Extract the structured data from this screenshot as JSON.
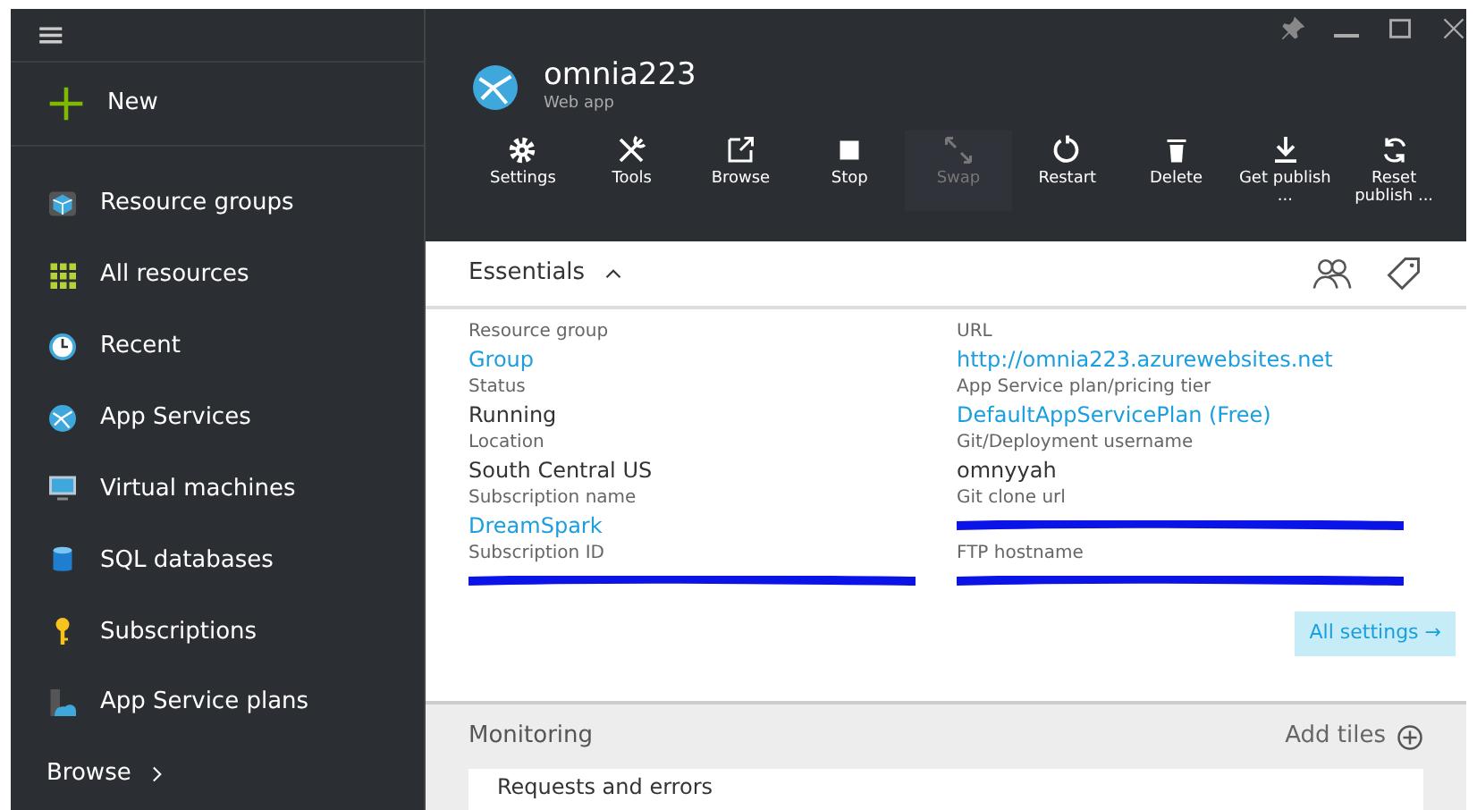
{
  "sidebar": {
    "menu_icon": "≡",
    "new_label": "New",
    "items": [
      {
        "label": "Resource groups"
      },
      {
        "label": "All resources"
      },
      {
        "label": "Recent"
      },
      {
        "label": "App Services"
      },
      {
        "label": "Virtual machines"
      },
      {
        "label": "SQL databases"
      },
      {
        "label": "Subscriptions"
      },
      {
        "label": "App Service plans"
      }
    ],
    "browse": "Browse"
  },
  "blade": {
    "title": "omnia223",
    "subtitle": "Web app",
    "toolbar": [
      {
        "label": "Settings",
        "disabled": false
      },
      {
        "label": "Tools",
        "disabled": false
      },
      {
        "label": "Browse",
        "disabled": false
      },
      {
        "label": "Stop",
        "disabled": false
      },
      {
        "label": "Swap",
        "disabled": true
      },
      {
        "label": "Restart",
        "disabled": false
      },
      {
        "label": "Delete",
        "disabled": false
      },
      {
        "label": "Get publish ...",
        "disabled": false
      },
      {
        "label": "Reset publish ...",
        "disabled": false
      }
    ]
  },
  "essentials": {
    "title": "Essentials",
    "expanded": true,
    "left": [
      {
        "label": "Resource group",
        "value": "Group",
        "kind": "link"
      },
      {
        "label": "Status",
        "value": "Running",
        "kind": "text"
      },
      {
        "label": "Location",
        "value": "South Central US",
        "kind": "text"
      },
      {
        "label": "Subscription name",
        "value": "DreamSpark",
        "kind": "link"
      },
      {
        "label": "Subscription ID",
        "kind": "redacted"
      }
    ],
    "right": [
      {
        "label": "URL",
        "value": "http://omnia223.azurewebsites.net",
        "kind": "link"
      },
      {
        "label": "App Service plan/pricing tier",
        "value": "DefaultAppServicePlan (Free)",
        "kind": "link"
      },
      {
        "label": "Git/Deployment username",
        "value": "omnyyah",
        "kind": "text"
      },
      {
        "label": "Git clone url",
        "kind": "redacted"
      },
      {
        "label": "FTP hostname",
        "kind": "redacted"
      }
    ],
    "all_settings": "All settings →"
  },
  "monitoring": {
    "title": "Monitoring",
    "add_tiles": "Add tiles",
    "tile_title": "Requests and errors"
  }
}
